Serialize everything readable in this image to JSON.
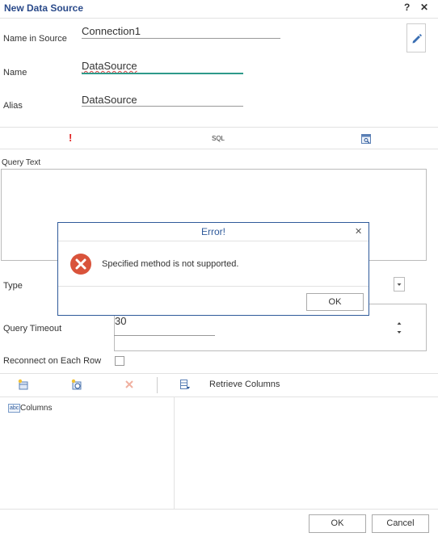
{
  "window": {
    "title": "New Data Source",
    "help_glyph": "?",
    "close_glyph": "✕"
  },
  "form": {
    "name_in_source": {
      "label": "Name in Source",
      "value": "Connection1"
    },
    "name": {
      "label": "Name",
      "value": "DataSource"
    },
    "alias": {
      "label": "Alias",
      "value": "DataSource"
    }
  },
  "query_toolbar": {
    "exclamation_glyph": "!",
    "sql_label": "SQL"
  },
  "query_text": {
    "label": "Query Text",
    "value": ""
  },
  "type": {
    "label": "Type",
    "value": ""
  },
  "query_timeout": {
    "label": "Query Timeout",
    "value": "30"
  },
  "reconnect": {
    "label": "Reconnect on Each Row",
    "checked": false
  },
  "columns_toolbar": {
    "retrieve_columns_label": "Retrieve Columns"
  },
  "tree": {
    "columns_badge": "abc",
    "columns_label": "Columns"
  },
  "footer": {
    "ok_label": "OK",
    "cancel_label": "Cancel"
  },
  "error_dialog": {
    "title": "Error!",
    "close_glyph": "✕",
    "message": "Specified method is not supported.",
    "ok_label": "OK"
  },
  "colors": {
    "title": "#2a4a8a",
    "accent_underline": "#2e9a8a",
    "error_icon": "#d9533b",
    "dialog_border": "#2f5a9a"
  }
}
